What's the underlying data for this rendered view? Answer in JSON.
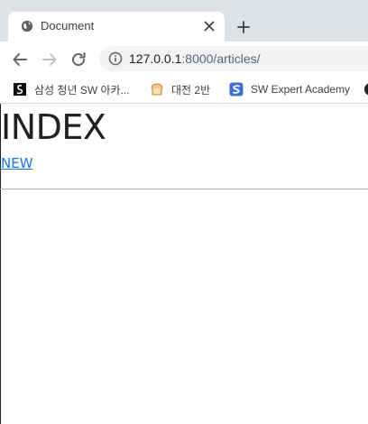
{
  "browser": {
    "tab": {
      "title": "Document"
    },
    "address": {
      "host": "127.0.0.1",
      "path": ":8000/articles/"
    },
    "bookmarks": [
      {
        "label": "삼성 청년 SW 아카...",
        "icon": "ssafy-icon"
      },
      {
        "label": "대전 2반",
        "icon": "bread-icon"
      },
      {
        "label": "SW Expert Academy",
        "icon": "swea-icon"
      }
    ]
  },
  "page": {
    "title": "INDEX",
    "new_link": "NEW"
  },
  "colors": {
    "tabstrip": "#dee1e6",
    "link": "#1a73e8",
    "omnibox": "#f1f3f4",
    "swea": "#3b6fd8"
  }
}
